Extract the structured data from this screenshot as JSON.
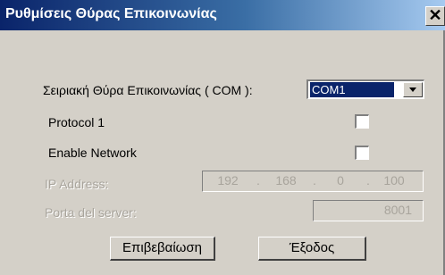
{
  "window": {
    "title": "Ρυθμίσεις Θύρας Επικοινωνίας",
    "close_glyph": "✕"
  },
  "port": {
    "label": "Σειριακή Θύρα Επικοινωνίας ( COM ):",
    "selected": "COM1"
  },
  "protocol": {
    "label": "Protocol 1",
    "checked": false
  },
  "network": {
    "label": "Enable Network",
    "checked": false
  },
  "ip": {
    "label": "IP Address:",
    "octets": [
      "192",
      "168",
      "0",
      "100"
    ]
  },
  "server_port": {
    "label": "Porta del server:",
    "value": "8001"
  },
  "buttons": {
    "confirm": "Επιβεβαίωση",
    "exit": "Έξοδος"
  },
  "colors": {
    "title_bar_start": "#0a246a",
    "title_bar_end": "#a6caf0",
    "dialog_bg": "#d4d0c8",
    "disabled_text": "#a8a49c"
  }
}
